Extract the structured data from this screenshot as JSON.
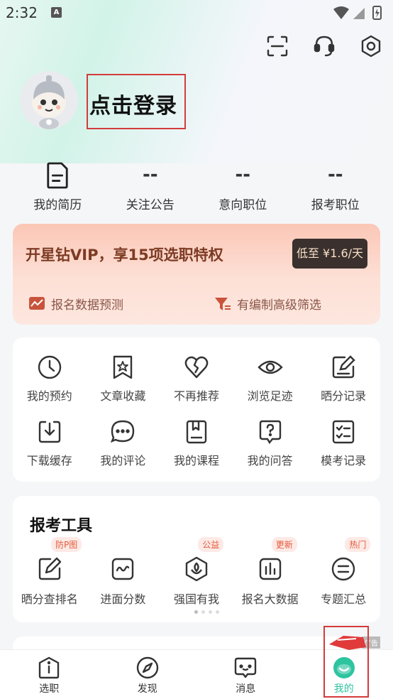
{
  "status_bar": {
    "time": "2:32",
    "notif_letter": "A"
  },
  "header_icons": [
    "scan-icon",
    "headset-icon",
    "settings-icon"
  ],
  "profile": {
    "login_label": "点击登录"
  },
  "stats": [
    {
      "value": "",
      "label": "我的简历"
    },
    {
      "value": "--",
      "label": "关注公告"
    },
    {
      "value": "--",
      "label": "意向职位"
    },
    {
      "value": "--",
      "label": "报考职位"
    }
  ],
  "vip": {
    "title": "开星钻VIP，享15项选职特权",
    "price": "低至 ¥1.6/天",
    "features": [
      "报名数据预测",
      "有编制高级筛选"
    ]
  },
  "grid": [
    {
      "label": "我的预约",
      "icon": "clock-icon"
    },
    {
      "label": "文章收藏",
      "icon": "bookmark-star-icon"
    },
    {
      "label": "不再推荐",
      "icon": "broken-heart-icon"
    },
    {
      "label": "浏览足迹",
      "icon": "eye-icon"
    },
    {
      "label": "晒分记录",
      "icon": "edit-note-icon"
    },
    {
      "label": "下载缓存",
      "icon": "download-icon"
    },
    {
      "label": "我的评论",
      "icon": "comment-icon"
    },
    {
      "label": "我的课程",
      "icon": "book-icon"
    },
    {
      "label": "我的问答",
      "icon": "question-icon"
    },
    {
      "label": "模考记录",
      "icon": "checklist-icon"
    }
  ],
  "tools": {
    "title": "报考工具",
    "items": [
      {
        "label": "晒分查排名",
        "badge": "防P图",
        "icon": "edit-icon"
      },
      {
        "label": "进面分数",
        "badge": "",
        "icon": "wave-chart-icon"
      },
      {
        "label": "强国有我",
        "badge": "公益",
        "icon": "emblem-icon"
      },
      {
        "label": "报名大数据",
        "badge": "更新",
        "icon": "bar-chart-icon"
      },
      {
        "label": "专题汇总",
        "badge": "热门",
        "icon": "topic-icon"
      }
    ]
  },
  "ad_tag": "广告",
  "tabbar": [
    {
      "label": "选职",
      "icon": "info-icon"
    },
    {
      "label": "发现",
      "icon": "compass-icon"
    },
    {
      "label": "消息",
      "icon": "message-icon"
    },
    {
      "label": "我的",
      "icon": "me-icon"
    }
  ],
  "colors": {
    "accent_green": "#2ec4a0",
    "vip_text": "#7d3b24",
    "highlight_red": "#d43b3b"
  }
}
